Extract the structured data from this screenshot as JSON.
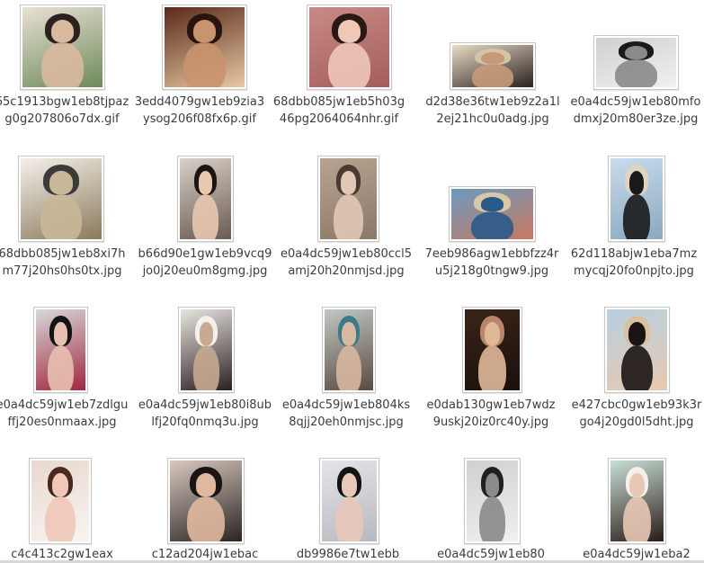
{
  "files": [
    {
      "name": "65c1913bgw1eb8tjpazg0g207806o7dx.gif",
      "icon": "image-thumbnail-icon",
      "colors": [
        "#e8e0d4",
        "#2b2220",
        "#d9b9a0",
        "#6e8a5a"
      ]
    },
    {
      "name": "3edd4079gw1eb9zia3ysog206f08fx6p.gif",
      "icon": "image-thumbnail-icon",
      "colors": [
        "#5a2a1a",
        "#2a1410",
        "#c8946e",
        "#e8c9a4"
      ]
    },
    {
      "name": "68dbb085jw1eb5h03g46pg2064064nhr.gif",
      "icon": "image-thumbnail-icon",
      "colors": [
        "#c98a86",
        "#2a1816",
        "#f0c8b8",
        "#a35e5a"
      ]
    },
    {
      "name": "d2d38e36tw1eb9z2a1l2ej21hc0u0adg.jpg",
      "icon": "image-thumbnail-icon",
      "colors": [
        "#e8dcc4",
        "#d4c4a8",
        "#c89a7a",
        "#2a2020"
      ]
    },
    {
      "name": "e0a4dc59jw1eb80mfodmxj20m80er3ze.jpg",
      "icon": "image-thumbnail-icon",
      "colors": [
        "#d0d0d0",
        "#1a1a1a",
        "#8a8a8a",
        "#f0f0f0"
      ]
    },
    {
      "name": "68dbb085jw1eb8xi7hm77j20hs0hs0tx.jpg",
      "icon": "image-thumbnail-icon",
      "colors": [
        "#f4f0ea",
        "#3a3a3a",
        "#c8b898",
        "#8a7a5a"
      ]
    },
    {
      "name": "b66d90e1gw1eb9vcq9jo0j20eu0m8gmg.jpg",
      "icon": "image-thumbnail-icon",
      "colors": [
        "#d8d0c8",
        "#1a1414",
        "#e8c8b0",
        "#6a5a50"
      ]
    },
    {
      "name": "e0a4dc59jw1eb80ccl5amj20h20nmjsd.jpg",
      "icon": "image-thumbnail-icon",
      "colors": [
        "#b8a490",
        "#4a3a30",
        "#e0c8b4",
        "#8a7868"
      ]
    },
    {
      "name": "7eeb986agw1ebbfzz4ru5j218g0tngw9.jpg",
      "icon": "image-thumbnail-icon",
      "colors": [
        "#6a9ac0",
        "#d8c8a8",
        "#2a5a8a",
        "#c87860"
      ]
    },
    {
      "name": "62d118abjw1eba7mzmycqj20fo0npjto.jpg",
      "icon": "image-thumbnail-icon",
      "colors": [
        "#c8dcec",
        "#e0d4c0",
        "#1a1a1a",
        "#8aa8c0"
      ]
    },
    {
      "name": "e0a4dc59jw1eb7zdlguffj20es0nmaax.jpg",
      "icon": "image-thumbnail-icon",
      "colors": [
        "#d8d8d8",
        "#141414",
        "#e8c0b0",
        "#a02840"
      ]
    },
    {
      "name": "e0a4dc59jw1eb80i8ublfj20fq0nmq3u.jpg",
      "icon": "image-thumbnail-icon",
      "colors": [
        "#e8e4e0",
        "#f4f0ec",
        "#c8a890",
        "#2a2020"
      ]
    },
    {
      "name": "e0a4dc59jw1eb804ks8qjj20eh0nmjsc.jpg",
      "icon": "image-thumbnail-icon",
      "colors": [
        "#c0c8c4",
        "#3a7a8a",
        "#d8b8a0",
        "#5a4a40"
      ]
    },
    {
      "name": "e0dab130gw1eb7wdz9uskj20iz0rc40y.jpg",
      "icon": "image-thumbnail-icon",
      "colors": [
        "#3a2418",
        "#b8846a",
        "#e0b898",
        "#1a100c"
      ]
    },
    {
      "name": "e427cbc0gw1eb93k3rgo4j20gd0l5dht.jpg",
      "icon": "image-thumbnail-icon",
      "colors": [
        "#b8d0e0",
        "#d8c0a0",
        "#1a1414",
        "#e8c8b0"
      ]
    },
    {
      "name": "c4c413c2gw1eax",
      "icon": "image-thumbnail-icon",
      "colors": [
        "#e8d8d0",
        "#4a2a20",
        "#f0c8b8",
        "#f8f4f0"
      ]
    },
    {
      "name": "c12ad204jw1ebac",
      "icon": "image-thumbnail-icon",
      "colors": [
        "#d8c8c0",
        "#1a1414",
        "#e0b8a0",
        "#2a2420"
      ]
    },
    {
      "name": "db9986e7tw1ebb",
      "icon": "image-thumbnail-icon",
      "colors": [
        "#e4e4e8",
        "#141414",
        "#e8c8b8",
        "#b8b8c0"
      ]
    },
    {
      "name": "e0a4dc59jw1eb80",
      "icon": "image-thumbnail-icon",
      "colors": [
        "#d0d0d0",
        "#202020",
        "#8a8a8a",
        "#f0f0f0"
      ]
    },
    {
      "name": "e0a4dc59jw1eba2",
      "icon": "image-thumbnail-icon",
      "colors": [
        "#c8e0d4",
        "#f4f0ec",
        "#e8c8b4",
        "#2a1a18"
      ]
    }
  ]
}
